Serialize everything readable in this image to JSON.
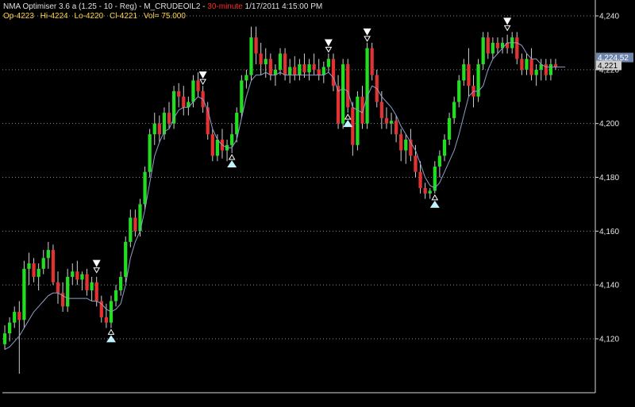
{
  "header": {
    "title_prefix": "NMA Optimiser 3.6 a (1.25 - 10 - Reg) - M_CRUDEOIL2 - ",
    "interval": "30-minute",
    "datetime": " 1/17/2011 4:15:00 PM",
    "ohlc": {
      "open": "Op-4223",
      "high": "Hi-4224",
      "low": "Lo-4220",
      "close": "Cl-4221",
      "volume": "Vol=  75.000"
    }
  },
  "colors": {
    "background": "#000000",
    "up": "#22dd22",
    "down": "#e23232",
    "wick": "#cfcfcf",
    "nma_line": "#8e9ec8",
    "grid": "#8a8a8a",
    "sell_marker": "#ffffff",
    "buy_marker": "#bff4ff",
    "price_tag": "#6d84ad",
    "last_tag": "#d0d0d0"
  },
  "chart_data": {
    "type": "candlestick",
    "ylim": [
      4103,
      4247
    ],
    "y_ticks": [
      4120,
      4140,
      4160,
      4180,
      4200,
      4220,
      4240
    ],
    "y_tick_labels": [
      "4,120",
      "4,140",
      "4,160",
      "4,180",
      "4,200",
      "4,220",
      "4,240"
    ],
    "grid": true,
    "current_price_label": "4,224.52",
    "last_close_label": "4,221",
    "current_price": 4224.52,
    "last_close": 4221,
    "candles": [
      [
        4118,
        4125,
        4116,
        4122
      ],
      [
        4122,
        4128,
        4119,
        4126
      ],
      [
        4126,
        4132,
        4124,
        4130
      ],
      [
        4130,
        4134,
        4107,
        4127
      ],
      [
        4127,
        4149,
        4124,
        4146
      ],
      [
        4146,
        4152,
        4140,
        4148
      ],
      [
        4148,
        4150,
        4141,
        4143
      ],
      [
        4143,
        4148,
        4138,
        4146
      ],
      [
        4146,
        4153,
        4144,
        4150
      ],
      [
        4150,
        4156,
        4146,
        4153
      ],
      [
        4153,
        4155,
        4140,
        4141
      ],
      [
        4141,
        4145,
        4133,
        4137
      ],
      [
        4137,
        4141,
        4130,
        4132
      ],
      [
        4132,
        4146,
        4130,
        4143
      ],
      [
        4143,
        4148,
        4140,
        4145
      ],
      [
        4145,
        4149,
        4140,
        4142
      ],
      [
        4142,
        4145,
        4138,
        4144
      ],
      [
        4144,
        4146,
        4136,
        4138
      ],
      [
        4138,
        4143,
        4134,
        4141
      ],
      [
        4141,
        4143,
        4132,
        4134
      ],
      [
        4134,
        4136,
        4126,
        4128
      ],
      [
        4128,
        4133,
        4124,
        4126
      ],
      [
        4126,
        4136,
        4124,
        4134
      ],
      [
        4134,
        4140,
        4132,
        4138
      ],
      [
        4138,
        4145,
        4136,
        4143
      ],
      [
        4143,
        4158,
        4141,
        4156
      ],
      [
        4156,
        4168,
        4154,
        4165
      ],
      [
        4165,
        4168,
        4158,
        4160
      ],
      [
        4160,
        4172,
        4158,
        4170
      ],
      [
        4170,
        4184,
        4168,
        4182
      ],
      [
        4182,
        4198,
        4180,
        4196
      ],
      [
        4196,
        4204,
        4192,
        4200
      ],
      [
        4200,
        4203,
        4193,
        4196
      ],
      [
        4196,
        4206,
        4194,
        4204
      ],
      [
        4204,
        4208,
        4198,
        4200
      ],
      [
        4200,
        4214,
        4198,
        4212
      ],
      [
        4212,
        4215,
        4206,
        4210
      ],
      [
        4210,
        4214,
        4203,
        4206
      ],
      [
        4206,
        4210,
        4203,
        4208
      ],
      [
        4208,
        4218,
        4206,
        4216
      ],
      [
        4216,
        4219,
        4210,
        4212
      ],
      [
        4212,
        4214,
        4204,
        4206
      ],
      [
        4206,
        4208,
        4194,
        4196
      ],
      [
        4196,
        4198,
        4186,
        4188
      ],
      [
        4188,
        4196,
        4186,
        4194
      ],
      [
        4194,
        4198,
        4187,
        4190
      ],
      [
        4190,
        4194,
        4186,
        4192
      ],
      [
        4192,
        4200,
        4189,
        4196
      ],
      [
        4196,
        4206,
        4193,
        4204
      ],
      [
        4204,
        4218,
        4202,
        4216
      ],
      [
        4216,
        4220,
        4213,
        4218
      ],
      [
        4218,
        4236,
        4216,
        4232
      ],
      [
        4232,
        4236,
        4222,
        4226
      ],
      [
        4226,
        4230,
        4218,
        4222
      ],
      [
        4222,
        4228,
        4217,
        4224
      ],
      [
        4224,
        4226,
        4216,
        4218
      ],
      [
        4218,
        4222,
        4214,
        4220
      ],
      [
        4220,
        4228,
        4218,
        4226
      ],
      [
        4226,
        4228,
        4216,
        4218
      ],
      [
        4218,
        4224,
        4215,
        4221
      ],
      [
        4221,
        4225,
        4216,
        4218
      ],
      [
        4218,
        4224,
        4216,
        4222
      ],
      [
        4222,
        4226,
        4217,
        4219
      ],
      [
        4219,
        4224,
        4216,
        4222
      ],
      [
        4222,
        4226,
        4218,
        4220
      ],
      [
        4220,
        4224,
        4216,
        4218
      ],
      [
        4218,
        4223,
        4215,
        4221
      ],
      [
        4221,
        4226,
        4219,
        4224
      ],
      [
        4224,
        4226,
        4212,
        4214
      ],
      [
        4214,
        4218,
        4198,
        4200
      ],
      [
        4200,
        4224,
        4198,
        4222
      ],
      [
        4222,
        4224,
        4204,
        4206
      ],
      [
        4206,
        4208,
        4188,
        4192
      ],
      [
        4192,
        4212,
        4190,
        4210
      ],
      [
        4210,
        4214,
        4198,
        4200
      ],
      [
        4200,
        4230,
        4198,
        4228
      ],
      [
        4228,
        4230,
        4216,
        4218
      ],
      [
        4218,
        4220,
        4206,
        4208
      ],
      [
        4208,
        4212,
        4198,
        4202
      ],
      [
        4202,
        4206,
        4198,
        4200
      ],
      [
        4200,
        4204,
        4196,
        4201
      ],
      [
        4201,
        4203,
        4193,
        4196
      ],
      [
        4196,
        4198,
        4186,
        4190
      ],
      [
        4190,
        4196,
        4185,
        4194
      ],
      [
        4194,
        4198,
        4186,
        4188
      ],
      [
        4188,
        4192,
        4180,
        4182
      ],
      [
        4182,
        4186,
        4174,
        4176
      ],
      [
        4176,
        4178,
        4172,
        4174
      ],
      [
        4174,
        4176,
        4172,
        4175
      ],
      [
        4175,
        4186,
        4174,
        4184
      ],
      [
        4184,
        4190,
        4180,
        4188
      ],
      [
        4188,
        4196,
        4186,
        4194
      ],
      [
        4194,
        4204,
        4192,
        4202
      ],
      [
        4202,
        4210,
        4200,
        4208
      ],
      [
        4208,
        4218,
        4206,
        4216
      ],
      [
        4216,
        4224,
        4214,
        4222
      ],
      [
        4222,
        4228,
        4210,
        4214
      ],
      [
        4214,
        4218,
        4206,
        4210
      ],
      [
        4210,
        4224,
        4208,
        4222
      ],
      [
        4222,
        4234,
        4220,
        4232
      ],
      [
        4232,
        4234,
        4224,
        4226
      ],
      [
        4226,
        4232,
        4224,
        4230
      ],
      [
        4230,
        4232,
        4226,
        4228
      ],
      [
        4228,
        4232,
        4226,
        4230
      ],
      [
        4230,
        4233,
        4226,
        4228
      ],
      [
        4228,
        4234,
        4226,
        4232
      ],
      [
        4232,
        4234,
        4222,
        4224
      ],
      [
        4224,
        4226,
        4218,
        4220
      ],
      [
        4220,
        4226,
        4218,
        4224
      ],
      [
        4224,
        4228,
        4216,
        4218
      ],
      [
        4218,
        4222,
        4214,
        4220
      ],
      [
        4220,
        4224,
        4216,
        4222
      ],
      [
        4222,
        4224,
        4216,
        4218
      ],
      [
        4218,
        4224,
        4216,
        4222
      ],
      [
        4222,
        4224,
        4220,
        4221
      ]
    ],
    "nma_line": [
      4116,
      4117,
      4119,
      4121,
      4124,
      4127,
      4130,
      4132,
      4134,
      4136,
      4137,
      4137,
      4136,
      4135,
      4135,
      4135,
      4135,
      4135,
      4134,
      4134,
      4133,
      4131,
      4130,
      4131,
      4133,
      4140,
      4150,
      4156,
      4160,
      4168,
      4178,
      4188,
      4193,
      4197,
      4198,
      4202,
      4205,
      4206,
      4206,
      4208,
      4210,
      4209,
      4205,
      4198,
      4194,
      4192,
      4191,
      4191,
      4194,
      4202,
      4210,
      4216,
      4218,
      4218,
      4219,
      4218,
      4218,
      4219,
      4218,
      4218,
      4218,
      4218,
      4218,
      4218,
      4218,
      4218,
      4218,
      4219,
      4217,
      4212,
      4213,
      4212,
      4206,
      4205,
      4204,
      4210,
      4214,
      4213,
      4210,
      4208,
      4206,
      4203,
      4199,
      4196,
      4193,
      4190,
      4185,
      4180,
      4177,
      4176,
      4178,
      4182,
      4186,
      4190,
      4196,
      4203,
      4210,
      4212,
      4212,
      4214,
      4220,
      4224,
      4226,
      4228,
      4230,
      4230,
      4230,
      4229,
      4226,
      4224,
      4224,
      4222,
      4221,
      4221,
      4221,
      4221,
      4221
    ],
    "signals": [
      {
        "bar": 19,
        "type": "sell",
        "price": 4144
      },
      {
        "bar": 22,
        "type": "buy",
        "price": 4124
      },
      {
        "bar": 41,
        "type": "sell",
        "price": 4214
      },
      {
        "bar": 47,
        "type": "buy",
        "price": 4189
      },
      {
        "bar": 67,
        "type": "sell",
        "price": 4226
      },
      {
        "bar": 71,
        "type": "buy",
        "price": 4204
      },
      {
        "bar": 75,
        "type": "sell",
        "price": 4230
      },
      {
        "bar": 89,
        "type": "buy",
        "price": 4174
      },
      {
        "bar": 104,
        "type": "sell",
        "price": 4234
      }
    ]
  }
}
